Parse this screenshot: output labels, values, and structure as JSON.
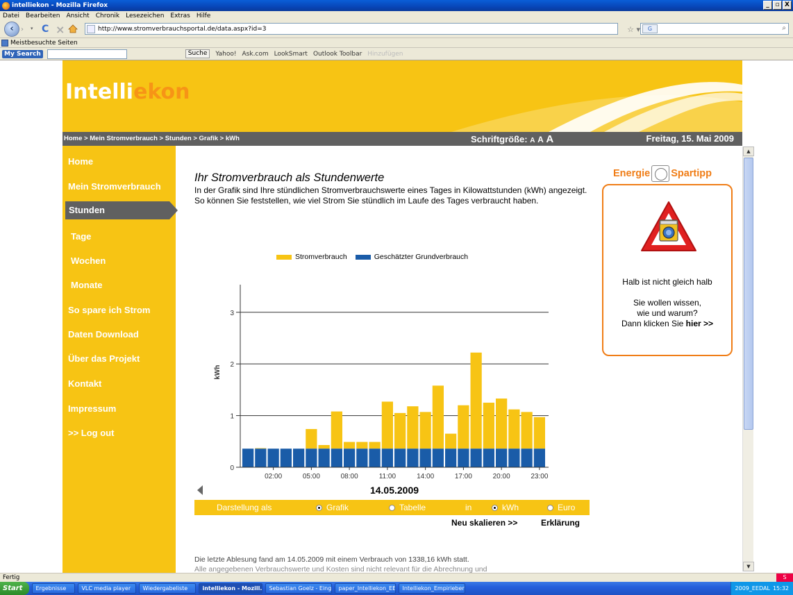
{
  "window": {
    "title": "intelliekon - Mozilla Firefox",
    "btn_min": "_",
    "btn_max": "▫",
    "btn_close": "X"
  },
  "menu": [
    "Datei",
    "Bearbeiten",
    "Ansicht",
    "Chronik",
    "Lesezeichen",
    "Extras",
    "Hilfe"
  ],
  "nav": {
    "url": "http://www.stromverbrauchsportal.de/data.aspx?id=3",
    "search_engine": "G"
  },
  "bookmarks": {
    "item": "Meistbesuchte Seiten"
  },
  "toolbar2": {
    "logo": "My Search",
    "search_btn": "Suche",
    "items": [
      "Yahoo!",
      "Ask.com",
      "LookSmart",
      "Outlook Toolbar"
    ],
    "hint": "Hinzufügen"
  },
  "site": {
    "logo_part1": "Intelli",
    "logo_part2": "ekon",
    "breadcrumb": "Home > Mein Stromverbrauch > Stunden > Grafik > kWh",
    "fontsize_label": "Schriftgröße:",
    "fontsize_a": "A",
    "date": "Freitag, 15. Mai 2009"
  },
  "sidebar": {
    "items": [
      {
        "label": "Home",
        "active": false
      },
      {
        "label": "Mein Stromverbrauch",
        "active": false
      },
      {
        "label": "Stunden",
        "active": true
      },
      {
        "label": "Tage",
        "active": false
      },
      {
        "label": "Wochen",
        "active": false
      },
      {
        "label": "Monate",
        "active": false
      },
      {
        "label": "So spare ich Strom",
        "active": false
      },
      {
        "label": "Daten Download",
        "active": false
      },
      {
        "label": "Über das Projekt",
        "active": false
      },
      {
        "label": "Kontakt",
        "active": false
      },
      {
        "label": "Impressum",
        "active": false
      },
      {
        "label": ">> Log out",
        "active": false
      }
    ]
  },
  "content": {
    "heading": "Ihr Stromverbrauch als Stundenwerte",
    "intro": "In der Grafik sind Ihre stündlichen Stromverbrauchswerte eines Tages in Kilowattstunden (kWh) angezeigt. So können Sie feststellen, wie viel Strom Sie stündlich im Laufe des Tages verbraucht haben.",
    "date": "14.05.2009",
    "controls": {
      "darstellung": "Darstellung als",
      "grafik": "Grafik",
      "tabelle": "Tabelle",
      "in": "in",
      "kwh": "kWh",
      "euro": "Euro"
    },
    "neu_skalieren": "Neu skalieren >>",
    "erklaerung": "Erklärung",
    "lastread": "Die letzte Ablesung fand am 14.05.2009 mit einem Verbrauch von 1338,16 kWh statt.",
    "lastread2": "Alle angegebenen Verbrauchswerte und Kosten sind nicht relevant für die Abrechnung und"
  },
  "chart_data": {
    "type": "bar",
    "stacked": true,
    "title": "",
    "xlabel": "",
    "ylabel": "kWh",
    "ylim": [
      0,
      3.4
    ],
    "yticks": [
      0,
      1,
      2,
      3
    ],
    "x_tick_labels": [
      "02:00",
      "05:00",
      "08:00",
      "11:00",
      "14:00",
      "17:00",
      "20:00",
      "23:00"
    ],
    "categories": [
      "00:00",
      "01:00",
      "02:00",
      "03:00",
      "04:00",
      "05:00",
      "06:00",
      "07:00",
      "08:00",
      "09:00",
      "10:00",
      "11:00",
      "12:00",
      "13:00",
      "14:00",
      "15:00",
      "16:00",
      "17:00",
      "18:00",
      "19:00",
      "20:00",
      "21:00",
      "22:00",
      "23:00"
    ],
    "series": [
      {
        "name": "Geschätzter Grundverbrauch",
        "color": "#1a5ca8",
        "values": [
          0.36,
          0.36,
          0.36,
          0.36,
          0.36,
          0.36,
          0.36,
          0.36,
          0.36,
          0.36,
          0.36,
          0.36,
          0.36,
          0.36,
          0.36,
          0.36,
          0.36,
          0.36,
          0.36,
          0.36,
          0.36,
          0.36,
          0.36,
          0.36
        ]
      },
      {
        "name": "Stromverbrauch",
        "color": "#f7c414",
        "values": [
          0.36,
          0.37,
          0.36,
          0.36,
          0.36,
          0.74,
          0.43,
          1.08,
          0.49,
          0.49,
          0.49,
          1.27,
          1.05,
          1.18,
          1.07,
          1.58,
          0.65,
          1.2,
          2.22,
          1.25,
          1.33,
          1.12,
          1.07,
          0.97
        ]
      }
    ],
    "legend_position": "top"
  },
  "tip": {
    "head1": "Energie",
    "head2": "Spartipp",
    "title": "Halb ist nicht gleich halb",
    "line1": "Sie wollen wissen,",
    "line2": "wie und warum?",
    "line3a": "Dann klicken Sie ",
    "line3b": "hier >>"
  },
  "status": {
    "text": "Fertig"
  },
  "taskbar": {
    "start": "Start",
    "tasks": [
      "Ergebnisse",
      "VLC media player",
      "Wiedergabeliste",
      "intelliekon - Mozill...",
      "Sebastian Goelz - Eing...",
      "paper_Intelliekon_EE...",
      "Intelliekon_Empirieberi..."
    ],
    "tray_item": "2009_EEDAL",
    "clock": "15:32"
  }
}
